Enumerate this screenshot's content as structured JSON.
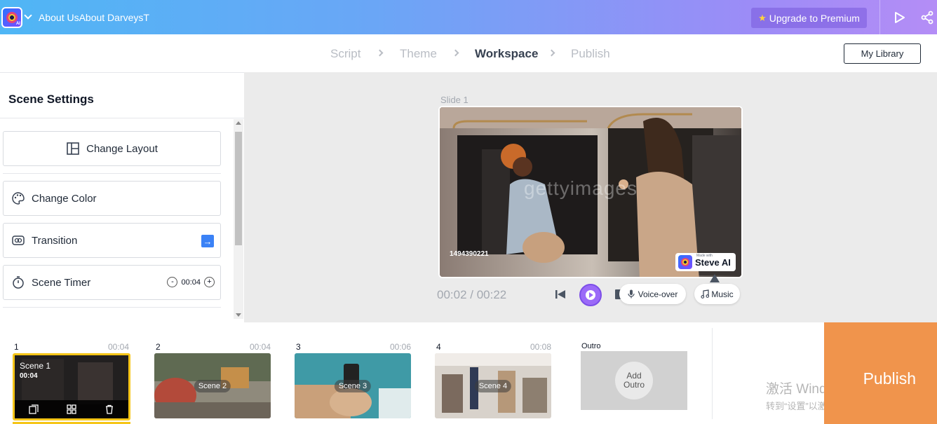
{
  "topbar": {
    "project_title": "About UsAbout DarveysTh",
    "upgrade_label": "Upgrade to Premium",
    "upgrade_icon": "star-icon",
    "colors": {
      "gradient_start": "#4fb6f5",
      "gradient_end": "#b48df6"
    }
  },
  "steps": {
    "items": [
      {
        "label": "Script",
        "active": false
      },
      {
        "label": "Theme",
        "active": false
      },
      {
        "label": "Workspace",
        "active": true
      },
      {
        "label": "Publish",
        "active": false
      }
    ],
    "library_label": "My Library"
  },
  "scene_settings": {
    "title": "Scene Settings",
    "change_layout": "Change Layout",
    "change_color": "Change Color",
    "transition": "Transition",
    "transition_arrow": "→",
    "scene_timer": "Scene Timer",
    "timer_value": "00:04",
    "timer_minus": "-",
    "timer_plus": "+"
  },
  "canvas": {
    "slide_label": "Slide 1",
    "stock_watermark": "gettyimages",
    "stock_id": "1494390221",
    "badge_made_with": "Made with",
    "badge_label": "Steve AI",
    "time_current": "00:02",
    "time_total": "00:22",
    "time_separator": " / ",
    "voiceover_label": "Voice-over",
    "music_label": "Music"
  },
  "timeline": {
    "scenes": [
      {
        "number": "1",
        "duration": "00:04",
        "label": "Scene 1",
        "time": "00:04",
        "selected": true
      },
      {
        "number": "2",
        "duration": "00:04",
        "label": "Scene 2",
        "selected": false
      },
      {
        "number": "3",
        "duration": "00:06",
        "label": "Scene 3",
        "selected": false
      },
      {
        "number": "4",
        "duration": "00:08",
        "label": "Scene 4",
        "selected": false
      }
    ],
    "outro_label": "Outro",
    "add_outro_line1": "Add",
    "add_outro_line2": "Outro"
  },
  "windows_watermark": {
    "line1": "激活 Windows",
    "line2": "转到“设置”以激活 Windows。"
  },
  "publish_label": "Publish",
  "colors": {
    "accent_purple": "#9b6af8",
    "publish_orange": "#f0944c",
    "selected_yellow": "#f5c518",
    "transition_blue": "#3b82f6"
  }
}
